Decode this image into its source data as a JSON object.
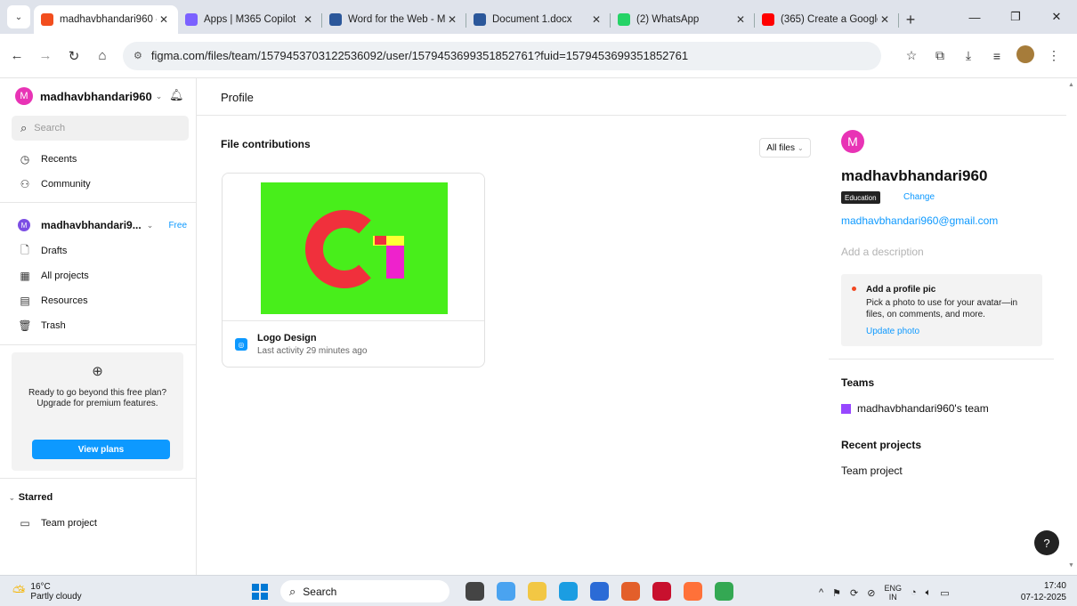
{
  "browser": {
    "tabs": [
      {
        "title": "madhavbhandari960 -",
        "icon": "figma-icon",
        "color": "#f24e1e",
        "active": true
      },
      {
        "title": "Apps | M365 Copilot",
        "icon": "copilot-icon",
        "color": "#7b61ff",
        "active": false
      },
      {
        "title": "Word for the Web - M",
        "icon": "word-icon",
        "color": "#2b579a",
        "active": false
      },
      {
        "title": "Document 1.docx",
        "icon": "word-icon",
        "color": "#2b579a",
        "active": false
      },
      {
        "title": "(2) WhatsApp",
        "icon": "whatsapp-icon",
        "color": "#25d366",
        "active": false
      },
      {
        "title": "(365) Create a Google",
        "icon": "youtube-icon",
        "color": "#ff0000",
        "active": false
      }
    ],
    "close_glyph": "✕",
    "new_tab_glyph": "+",
    "url": "figma.com/files/team/1579453703122536092/user/1579453699351852761?fuid=1579453699351852761"
  },
  "sidebar": {
    "avatar_letter": "M",
    "username": "madhavbhandari960",
    "search_placeholder": "Search",
    "nav_top": [
      {
        "label": "Recents",
        "icon": "clock-icon",
        "glyph": "◷"
      },
      {
        "label": "Community",
        "icon": "community-icon",
        "glyph": "⚇"
      }
    ],
    "team": {
      "avatar_letter": "M",
      "name": "madhavbhandari9...",
      "plan": "Free"
    },
    "nav_team": [
      {
        "label": "Drafts",
        "icon": "file-icon",
        "glyph": "🗋"
      },
      {
        "label": "All projects",
        "icon": "grid-icon",
        "glyph": "▦"
      },
      {
        "label": "Resources",
        "icon": "resources-icon",
        "glyph": "▤"
      },
      {
        "label": "Trash",
        "icon": "trash-icon",
        "glyph": "🗑"
      }
    ],
    "upgrade": {
      "text": "Ready to go beyond this free plan? Upgrade for premium features.",
      "button": "View plans"
    },
    "starred_label": "Starred",
    "starred_items": [
      {
        "label": "Team project",
        "icon": "folder-icon",
        "glyph": "▭"
      }
    ]
  },
  "main": {
    "header_title": "Profile",
    "section_title": "File contributions",
    "filter_label": "All files",
    "files": [
      {
        "name": "Logo Design",
        "activity": "Last activity 29 minutes ago"
      }
    ]
  },
  "profile": {
    "avatar_letter": "M",
    "name": "madhavbhandari960",
    "badge": "Education",
    "change_label": "Change",
    "email": "madhavbhandari960@gmail.com",
    "description_placeholder": "Add a description",
    "pic_card": {
      "title": "Add a profile pic",
      "description": "Pick a photo to use for your avatar—in files, on comments, and more.",
      "link": "Update photo"
    },
    "teams_label": "Teams",
    "teams": [
      {
        "name": "madhavbhandari960's team",
        "color": "#9747ff"
      }
    ],
    "recent_projects_label": "Recent projects",
    "recent_projects": [
      "Team project"
    ]
  },
  "help_label": "?",
  "taskbar": {
    "temperature": "16°C",
    "weather": "Partly cloudy",
    "search_label": "Search",
    "apps": [
      {
        "icon": "task-view-icon",
        "color": "#444444"
      },
      {
        "icon": "copilot-icon",
        "color": "#4aa3f0"
      },
      {
        "icon": "file-explorer-icon",
        "color": "#f2c744"
      },
      {
        "icon": "edge-icon",
        "color": "#1b9de2"
      },
      {
        "icon": "store-icon",
        "color": "#2b6bd6"
      },
      {
        "icon": "copilot-app-icon",
        "color": "#e35f2a"
      },
      {
        "icon": "mcafee-icon",
        "color": "#c8102e"
      },
      {
        "icon": "firefox-icon",
        "color": "#ff7139"
      },
      {
        "icon": "chrome-icon",
        "color": "#34a853"
      }
    ],
    "lang_top": "ENG",
    "lang_bottom": "IN",
    "time": "17:40",
    "date": "07-12-2025"
  }
}
